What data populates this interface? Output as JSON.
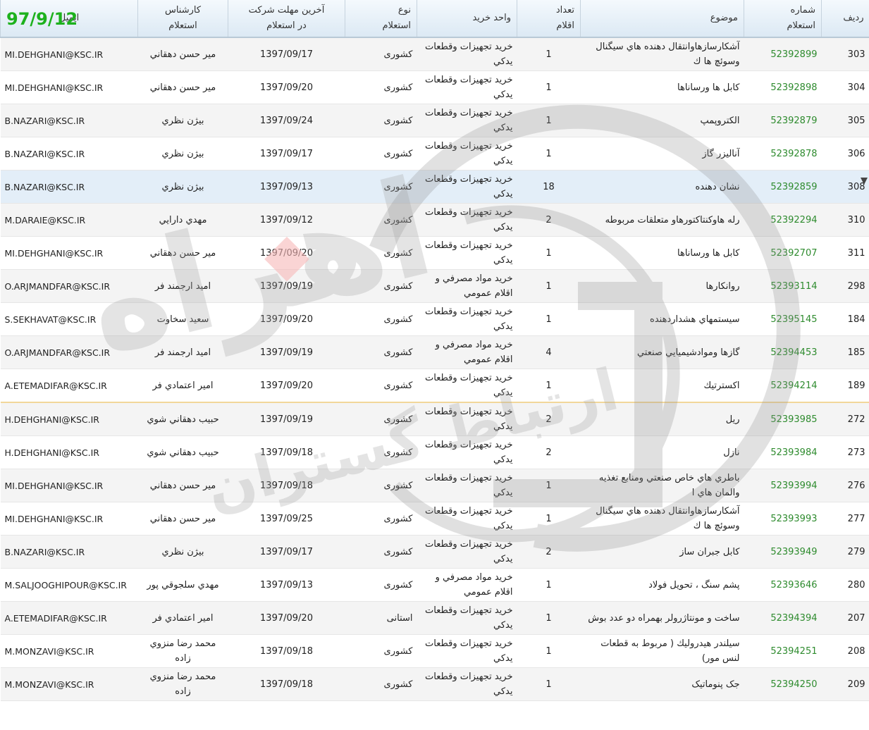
{
  "date_badge": "97/9/12",
  "watermark": {
    "brand_text": "اهراه",
    "sub_text": "ارتباط گستران"
  },
  "headers": {
    "row": "رديف",
    "number": [
      "شماره",
      "استعلام"
    ],
    "subject": "موضوع",
    "count": [
      "تعداد",
      "اقلام"
    ],
    "unit": "واحد خريد",
    "type": [
      "نوع",
      "استعلام"
    ],
    "deadline": [
      "آخرين مهلت شركت",
      "در استعلام"
    ],
    "expert": [
      "كارشناس",
      "استعلام"
    ],
    "email": "ايميل"
  },
  "rows": [
    {
      "row": "303",
      "number": "52392899",
      "subject": "آشكارسازهاوانتقال دهنده هاي سيگنال وسوئچ ها ك",
      "count": "1",
      "unit": "خريد تجهيزات وقطعات يدكي",
      "type": "كشوری",
      "deadline": "1397/09/17",
      "expert": "مير حسن دهقاني",
      "email": "MI.DEHGHANI@KSC.IR"
    },
    {
      "row": "304",
      "number": "52392898",
      "subject": "كابل ها ورساناها",
      "count": "1",
      "unit": "خريد تجهيزات وقطعات يدكي",
      "type": "كشوری",
      "deadline": "1397/09/20",
      "expert": "مير حسن دهقاني",
      "email": "MI.DEHGHANI@KSC.IR"
    },
    {
      "row": "305",
      "number": "52392879",
      "subject": "الكتروپمپ",
      "count": "1",
      "unit": "خريد تجهيزات وقطعات يدكي",
      "type": "كشوری",
      "deadline": "1397/09/24",
      "expert": "بيژن نظري",
      "email": "B.NAZARI@KSC.IR"
    },
    {
      "row": "306",
      "number": "52392878",
      "subject": "آناليزر گاز",
      "count": "1",
      "unit": "خريد تجهيزات وقطعات يدكي",
      "type": "كشوری",
      "deadline": "1397/09/17",
      "expert": "بيژن نظري",
      "email": "B.NAZARI@KSC.IR"
    },
    {
      "row": "308",
      "number": "52392859",
      "subject": "نشان دهنده",
      "count": "18",
      "unit": "خريد تجهيزات وقطعات يدكي",
      "type": "كشوری",
      "deadline": "1397/09/13",
      "expert": "بيژن نظري",
      "email": "B.NAZARI@KSC.IR"
    },
    {
      "row": "310",
      "number": "52392294",
      "subject": "رله هاوكنتاكتورهاو متعلقات مربوطه",
      "count": "2",
      "unit": "خريد تجهيزات وقطعات يدكي",
      "type": "كشوری",
      "deadline": "1397/09/12",
      "expert": "مهدي دارايي",
      "email": "M.DARAIE@KSC.IR"
    },
    {
      "row": "311",
      "number": "52392707",
      "subject": "كابل ها ورساناها",
      "count": "1",
      "unit": "خريد تجهيزات وقطعات يدكي",
      "type": "كشوری",
      "deadline": "1397/09/20",
      "expert": "مير حسن دهقاني",
      "email": "MI.DEHGHANI@KSC.IR"
    },
    {
      "row": "298",
      "number": "52393114",
      "subject": "روانكارها",
      "count": "1",
      "unit": "خريد مواد مصرفي و اقلام عمومي",
      "type": "كشوری",
      "deadline": "1397/09/19",
      "expert": "اميد ارجمند فر",
      "email": "O.ARJMANDFAR@KSC.IR"
    },
    {
      "row": "184",
      "number": "52395145",
      "subject": "سيستمهاي هشداردهنده",
      "count": "1",
      "unit": "خريد تجهيزات وقطعات يدكي",
      "type": "كشوری",
      "deadline": "1397/09/20",
      "expert": "سعيد سخاوت",
      "email": "S.SEKHAVAT@KSC.IR"
    },
    {
      "row": "185",
      "number": "52394453",
      "subject": "گازها وموادشيميايي صنعتي",
      "count": "4",
      "unit": "خريد مواد مصرفي و اقلام عمومي",
      "type": "كشوری",
      "deadline": "1397/09/19",
      "expert": "اميد ارجمند فر",
      "email": "O.ARJMANDFAR@KSC.IR"
    },
    {
      "row": "189",
      "number": "52394214",
      "subject": "اكسترتيك",
      "count": "1",
      "unit": "خريد تجهيزات وقطعات يدكي",
      "type": "كشوری",
      "deadline": "1397/09/20",
      "expert": "امير اعتمادي فر",
      "email": "A.ETEMADIFAR@KSC.IR"
    },
    {
      "row": "272",
      "number": "52393985",
      "subject": "ريل",
      "count": "2",
      "unit": "خريد تجهيزات وقطعات يدكي",
      "type": "كشوری",
      "deadline": "1397/09/19",
      "expert": "حبيب دهقاني شوي",
      "email": "H.DEHGHANI@KSC.IR"
    },
    {
      "row": "273",
      "number": "52393984",
      "subject": "نازل",
      "count": "2",
      "unit": "خريد تجهيزات وقطعات يدكي",
      "type": "كشوری",
      "deadline": "1397/09/18",
      "expert": "حبيب دهقاني شوي",
      "email": "H.DEHGHANI@KSC.IR"
    },
    {
      "row": "276",
      "number": "52393994",
      "subject": "باطري هاي خاص صنعتي ومنابع تغذيه والمان هاي ا",
      "count": "1",
      "unit": "خريد تجهيزات وقطعات يدكي",
      "type": "كشوری",
      "deadline": "1397/09/18",
      "expert": "مير حسن دهقاني",
      "email": "MI.DEHGHANI@KSC.IR"
    },
    {
      "row": "277",
      "number": "52393993",
      "subject": "آشكارسازهاوانتقال دهنده هاي سيگنال وسوئچ ها ك",
      "count": "1",
      "unit": "خريد تجهيزات وقطعات يدكي",
      "type": "كشوری",
      "deadline": "1397/09/25",
      "expert": "مير حسن دهقاني",
      "email": "MI.DEHGHANI@KSC.IR"
    },
    {
      "row": "279",
      "number": "52393949",
      "subject": "كابل جبران ساز",
      "count": "2",
      "unit": "خريد تجهيزات وقطعات يدكي",
      "type": "كشوری",
      "deadline": "1397/09/17",
      "expert": "بيژن نظري",
      "email": "B.NAZARI@KSC.IR"
    },
    {
      "row": "280",
      "number": "52393646",
      "subject": "پشم سنگ ، تحويل فولاد",
      "count": "1",
      "unit": "خريد مواد مصرفي و اقلام عمومي",
      "type": "كشوری",
      "deadline": "1397/09/13",
      "expert": "مهدي سلجوقي پور",
      "email": "M.SALJOOGHIPOUR@KSC.IR"
    },
    {
      "row": "207",
      "number": "52394394",
      "subject": "ساخت و مونتاژرولر بهمراه دو عدد بوش",
      "count": "1",
      "unit": "خريد تجهيزات وقطعات يدكي",
      "type": "استانی",
      "deadline": "1397/09/20",
      "expert": "امير اعتمادي فر",
      "email": "A.ETEMADIFAR@KSC.IR"
    },
    {
      "row": "208",
      "number": "52394251",
      "subject": "سيلندر هيدروليك ( مربوط به قطعات لنس مور)",
      "count": "1",
      "unit": "خريد تجهيزات وقطعات يدكي",
      "type": "كشوری",
      "deadline": "1397/09/18",
      "expert": "محمد رضا منزوي زاده",
      "email": "M.MONZAVI@KSC.IR"
    },
    {
      "row": "209",
      "number": "52394250",
      "subject": "جک پنوماتيک",
      "count": "1",
      "unit": "خريد تجهيزات وقطعات يدكي",
      "type": "كشوری",
      "deadline": "1397/09/18",
      "expert": "محمد رضا منزوي زاده",
      "email": "M.MONZAVI@KSC.IR"
    }
  ]
}
